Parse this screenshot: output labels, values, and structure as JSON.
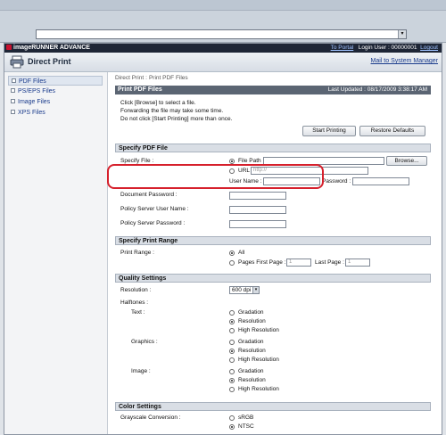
{
  "browser": {
    "address_btn_icon": "chevron-down-icon"
  },
  "topbar": {
    "logo": "imageRUNNER ADVANCE",
    "to_portal": "To Portal",
    "login_user": "Login User : 00000001",
    "logout": "Logout"
  },
  "header": {
    "title": "Direct Print",
    "mail": "Mail to System Manager"
  },
  "sidebar": {
    "items": [
      {
        "label": "PDF Files"
      },
      {
        "label": "PS/EPS Files"
      },
      {
        "label": "Image Files"
      },
      {
        "label": "XPS Files"
      }
    ]
  },
  "breadcrumb": {
    "root": "Direct Print",
    "sep": ":",
    "current": "Print PDF Files"
  },
  "panel": {
    "title": "Print PDF Files",
    "last_updated": "Last Updated : 08/17/2009 3:38:17 AM",
    "instructions": [
      "Click [Browse] to select a file.",
      "Forwarding the file may take some time.",
      "Do not click [Start Printing] more than once."
    ],
    "start_btn": "Start Printing",
    "restore_btn": "Restore Defaults"
  },
  "specify_file": {
    "section": "Specify PDF File",
    "label": "Specify File :",
    "file_path": "File Path",
    "browse": "Browse...",
    "url": "URL",
    "url_placeholder": "http://",
    "user_name": "User Name :",
    "password": "Password :",
    "doc_password": "Document Password :",
    "policy_user": "Policy Server User Name :",
    "policy_pass": "Policy Server Password :"
  },
  "print_range": {
    "section": "Specify Print Range",
    "label": "Print Range :",
    "all": "All",
    "pages_first": "Pages First Page :",
    "first_value": "1",
    "last_label": "Last Page :",
    "last_value": "1"
  },
  "quality": {
    "section": "Quality Settings",
    "resolution_label": "Resolution :",
    "resolution_value": "600 dpi",
    "halftones": "Halftones :",
    "text": "Text :",
    "graphics": "Graphics :",
    "image": "Image :",
    "gradation": "Gradation",
    "resolution_opt": "Resolution",
    "high_res": "High Resolution"
  },
  "color": {
    "section": "Color Settings",
    "grayscale": "Grayscale Conversion :",
    "srgb": "sRGB",
    "ntsc": "NTSC"
  },
  "colors": {
    "highlight": "#d6202c",
    "title_bar": "#5b6573",
    "topbar": "#1e2636",
    "link": "#1a3b8c"
  }
}
